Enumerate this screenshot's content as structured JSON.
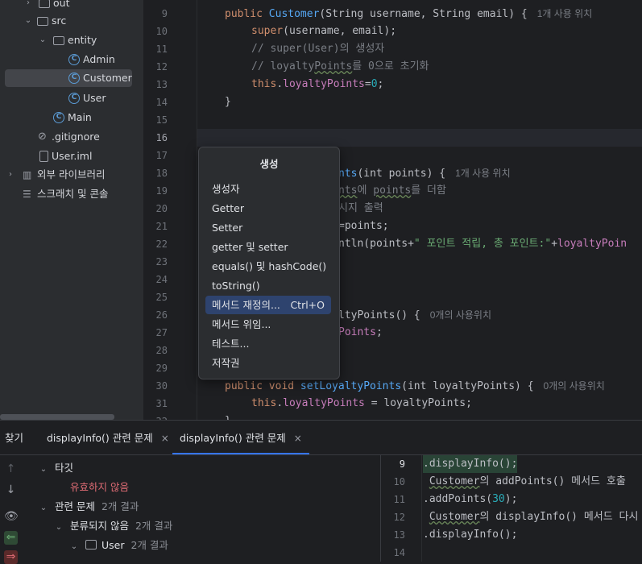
{
  "tree": {
    "items": [
      {
        "label": "out"
      },
      {
        "label": "src"
      },
      {
        "label": "entity"
      },
      {
        "label": "Admin"
      },
      {
        "label": "Customer"
      },
      {
        "label": "User"
      },
      {
        "label": "Main"
      },
      {
        "label": ".gitignore"
      },
      {
        "label": "User.iml"
      },
      {
        "label": "외부 라이브러리"
      },
      {
        "label": "스크래치 및 콘솔"
      }
    ]
  },
  "editor": {
    "line_numbers": [
      "9",
      "10",
      "11",
      "12",
      "13",
      "14",
      "15",
      "16",
      "17",
      "18",
      "19",
      "20",
      "21",
      "22",
      "23",
      "24",
      "25",
      "26",
      "27",
      "28",
      "29",
      "30",
      "31",
      "32"
    ],
    "l9": {
      "kw": "public",
      "fn": "Customer",
      "rest": "(String username, String email) {",
      "hint": "1개 사용 위치"
    },
    "l10": {
      "kw": "super",
      "rest": "(username, email);"
    },
    "l11": {
      "cmt": "// super(User)의 생성자"
    },
    "l12": {
      "cmt_a": "// loyalty",
      "cmt_b": "Points",
      "cmt_c": "를 0으로 초기화"
    },
    "l13": {
      "kw": "this",
      "dot": ".",
      "fld": "loyaltyPoints",
      "eq": "=",
      "num": "0",
      "end": ";"
    },
    "l14": {
      "code": "}"
    },
    "l18": {
      "fn": "nts",
      "rest": "(int points) {",
      "hint": "1개 사용 위치"
    },
    "l19": {
      "cmt_a": "nts",
      "cmt_b": "에 ",
      "cmt_c": "points",
      "cmt_d": "를 더함"
    },
    "l20": {
      "cmt": "시지 출력"
    },
    "l21": {
      "code": "=points;"
    },
    "l22": {
      "a": "ntln(points+",
      "str": "\" 포인트 적립, 총 포인트:\"",
      "b": "+",
      "fld": "loyaltyPoin"
    },
    "l26": {
      "a": "ltyPoints() {",
      "hint": "0개의 사용위치"
    },
    "l27": {
      "fld": "Points",
      "end": ";"
    },
    "l30": {
      "kw": "public void",
      "fn": "setLoyaltyPoints",
      "rest": "(int loyaltyPoints) {",
      "hint": "0개의 사용위치"
    },
    "l31": {
      "kw": "this",
      "dot": ".",
      "fld": "loyaltyPoints",
      "rest": " = loyaltyPoints;"
    },
    "l32": {
      "code": "}"
    }
  },
  "popup": {
    "title": "생성",
    "items": [
      {
        "label": "생성자",
        "shortcut": ""
      },
      {
        "label": "Getter",
        "shortcut": ""
      },
      {
        "label": "Setter",
        "shortcut": ""
      },
      {
        "label": "getter 및 setter",
        "shortcut": ""
      },
      {
        "label": "equals() 및 hashCode()",
        "shortcut": ""
      },
      {
        "label": "toString()",
        "shortcut": ""
      },
      {
        "label": "메서드 재정의...",
        "shortcut": "Ctrl+O"
      },
      {
        "label": "메서드 위임...",
        "shortcut": ""
      },
      {
        "label": "테스트...",
        "shortcut": ""
      },
      {
        "label": "저작권",
        "shortcut": ""
      }
    ]
  },
  "panel": {
    "find_label": "찾기",
    "tabs": [
      {
        "label": "displayInfo() 관련 문제",
        "close": "×"
      },
      {
        "label": "displayInfo() 관련 문제",
        "close": "×"
      }
    ],
    "results": {
      "target_label": "타깃",
      "invalid_label": "유효하지 않음",
      "related_label": "관련 문제",
      "related_count": "2개 결과",
      "uncategorized_label": "분류되지 않음",
      "uncategorized_count": "2개 결과",
      "user_label": "User",
      "user_count": "2개 결과"
    },
    "preview": {
      "line_numbers": [
        "9",
        "10",
        "11",
        "12",
        "13",
        "14"
      ],
      "l9": ".displayInfo();",
      "l10": {
        "a": "Customer",
        "b": "의 addPoints() 메서드 호출"
      },
      "l11": {
        "a": ".addPoints(",
        "num": "30",
        "b": ");"
      },
      "l12": {
        "a": "Customer",
        "b": "의 displayInfo() 메서드 다시"
      },
      "l13": ".displayInfo();"
    }
  },
  "colors": {
    "accent": "#3574f0",
    "selection": "#2e436e",
    "keyword": "#cf8e6d",
    "function": "#56a8f5",
    "field": "#c77dbb",
    "string": "#6aab73",
    "number": "#2aacb8",
    "error": "#e06c75"
  }
}
